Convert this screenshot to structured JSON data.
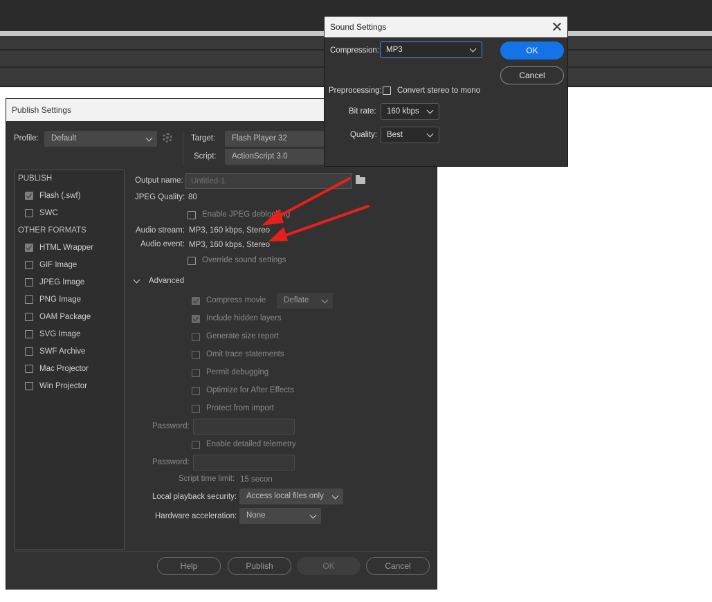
{
  "publish": {
    "window_title": "Publish Settings",
    "profile_label": "Profile:",
    "profile_value": "Default",
    "target_label": "Target:",
    "target_value": "Flash Player 32",
    "script_label": "Script:",
    "script_value": "ActionScript 3.0",
    "sidebar": {
      "publish_header": "PUBLISH",
      "publish_items": [
        {
          "label": "Flash (.swf)",
          "checked": true
        },
        {
          "label": "SWC",
          "checked": false
        }
      ],
      "other_header": "OTHER FORMATS",
      "other_items": [
        {
          "label": "HTML Wrapper",
          "checked": true
        },
        {
          "label": "GIF Image",
          "checked": false
        },
        {
          "label": "JPEG Image",
          "checked": false
        },
        {
          "label": "PNG Image",
          "checked": false
        },
        {
          "label": "OAM Package",
          "checked": false
        },
        {
          "label": "SVG Image",
          "checked": false
        },
        {
          "label": "SWF Archive",
          "checked": false
        },
        {
          "label": "Mac Projector",
          "checked": false
        },
        {
          "label": "Win Projector",
          "checked": false
        }
      ]
    },
    "output_name_label": "Output name:",
    "output_name_value": "Untitled-1",
    "jpeg_quality_label": "JPEG Quality:",
    "jpeg_quality_value": "80",
    "enable_jpeg_deblocking": "Enable JPEG deblocking",
    "audio_stream_label": "Audio stream:",
    "audio_stream_value": "MP3, 160 kbps, Stereo",
    "audio_event_label": "Audio event:",
    "audio_event_value": "MP3, 160 kbps, Stereo",
    "override_sound": "Override sound settings",
    "advanced_label": "Advanced",
    "compress_movie": "Compress movie",
    "compress_method": "Deflate",
    "include_hidden_layers": "Include hidden layers",
    "generate_size_report": "Generate size report",
    "omit_trace": "Omit trace statements",
    "permit_debugging": "Permit debugging",
    "optimize_after_effects": "Optimize for After Effects",
    "protect_from_import": "Protect from import",
    "password_label": "Password:",
    "enable_telemetry": "Enable detailed telemetry",
    "password2_label": "Password:",
    "script_time_limit_label": "Script time limit:",
    "script_time_limit_value": "15 secon",
    "local_playback_label": "Local playback security:",
    "local_playback_value": "Access local files only",
    "hw_accel_label": "Hardware acceleration:",
    "hw_accel_value": "None",
    "buttons": {
      "help": "Help",
      "publish": "Publish",
      "ok": "OK",
      "cancel": "Cancel"
    }
  },
  "sound": {
    "title": "Sound Settings",
    "compression_label": "Compression:",
    "compression_value": "MP3",
    "preprocessing_label": "Preprocessing:",
    "convert_stereo": "Convert stereo to mono",
    "bitrate_label": "Bit rate:",
    "bitrate_value": "160 kbps",
    "quality_label": "Quality:",
    "quality_value": "Best",
    "ok": "OK",
    "cancel": "Cancel"
  },
  "colors": {
    "accent": "#1473e6",
    "annotation": "#e8201c",
    "dialog_bg": "#323232",
    "titlebar": "#f2f2f2"
  }
}
